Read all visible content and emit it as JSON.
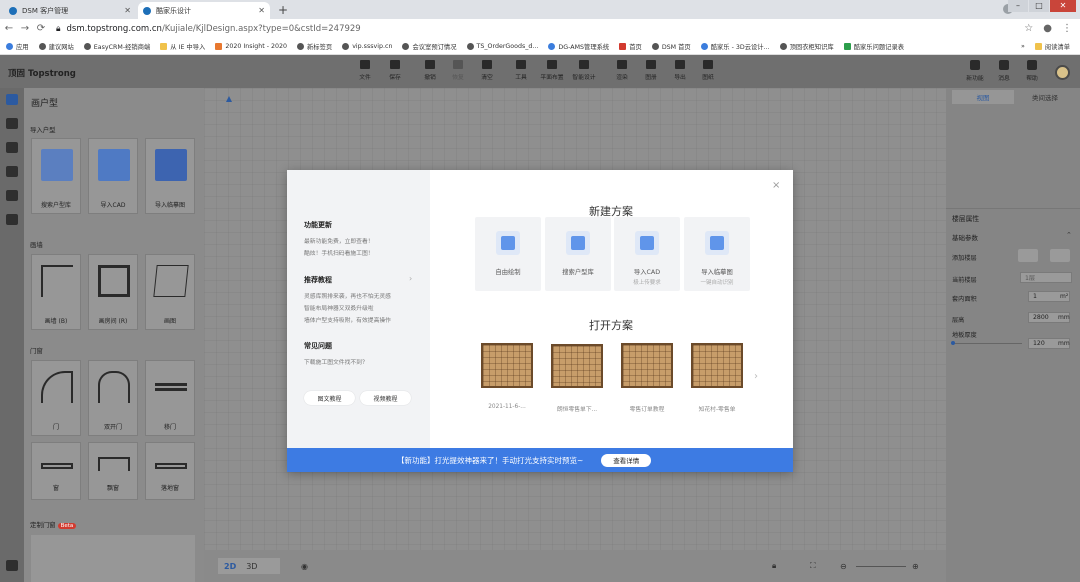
{
  "browser": {
    "tabs": [
      {
        "label": "DSM 客户管理"
      },
      {
        "label": "酷家乐设计"
      }
    ],
    "url_host": "dsm.topstrong.com.cn",
    "url_path": "/Kujiale/KjlDesign.aspx?type=0&cstId=247929",
    "bookmarks": [
      {
        "label": "应用",
        "icon": "apps-icon"
      },
      {
        "label": "建议网站",
        "icon": "globe-icon"
      },
      {
        "label": "EasyCRM-经销商端",
        "icon": "globe-icon"
      },
      {
        "label": "从 IE 中导入",
        "icon": "folder-icon"
      },
      {
        "label": "2020 Insight - 2020",
        "icon": "insight-icon"
      },
      {
        "label": "新标签页",
        "icon": "globe-icon"
      },
      {
        "label": "vip.sssvip.cn",
        "icon": "globe-icon"
      },
      {
        "label": "会议室预订情况",
        "icon": "globe-icon"
      },
      {
        "label": "TS_OrderGoods_d...",
        "icon": "globe-icon"
      },
      {
        "label": "DG-AMS管理系统",
        "icon": "doc-icon"
      },
      {
        "label": "首页",
        "icon": "home-icon"
      },
      {
        "label": "DSM 首页",
        "icon": "globe-icon"
      },
      {
        "label": "酷家乐 - 3D云设计...",
        "icon": "globe-icon"
      },
      {
        "label": "顶固衣柜知识库",
        "icon": "globe-icon"
      },
      {
        "label": "酷家乐问题记录表",
        "icon": "sheet-icon"
      }
    ],
    "bookmark_more": "»",
    "reading_list": "阅读清单"
  },
  "app": {
    "logo": "顶固 Topstrong",
    "toolbar": [
      {
        "label": "文件",
        "icon": "file-icon"
      },
      {
        "label": "保存",
        "icon": "save-icon"
      },
      {
        "label": "撤销",
        "icon": "undo-icon"
      },
      {
        "label": "恢复",
        "icon": "redo-icon"
      },
      {
        "label": "清空",
        "icon": "clear-icon"
      },
      {
        "label": "工具",
        "icon": "tools-icon"
      },
      {
        "label": "平面布置",
        "icon": "layout-icon"
      },
      {
        "label": "智能设计",
        "icon": "smart-icon"
      },
      {
        "label": "渲染",
        "icon": "camera-icon"
      },
      {
        "label": "图册",
        "icon": "album-icon"
      },
      {
        "label": "导出",
        "icon": "export-icon"
      },
      {
        "label": "图纸",
        "icon": "drawing-icon"
      }
    ],
    "right_tools": [
      {
        "label": "新功能",
        "icon": "new-feature-icon"
      },
      {
        "label": "消息",
        "icon": "bell-icon"
      },
      {
        "label": "帮助",
        "icon": "help-icon"
      }
    ],
    "library": {
      "title": "画户型",
      "section_import": "导入户型",
      "import_items": [
        "搜索户型库",
        "导入CAD",
        "导入临摹图"
      ],
      "section_wall": "画墙",
      "wall_items": [
        "画墙 (B)",
        "画房间 (R)",
        "画图"
      ],
      "section_door": "门窗",
      "door_items": [
        "门",
        "双开门",
        "移门",
        "窗",
        "飘窗",
        "落地窗"
      ],
      "section_custom": "定制门窗",
      "custom_badge": "Beta"
    },
    "view": {
      "mode_2d": "2D",
      "mode_3d": "3D"
    },
    "right_panel": {
      "tabs": [
        "视图",
        "类间选择"
      ],
      "section_title": "楼层属性",
      "sub_title": "基础参数",
      "rows": [
        {
          "label": "添加楼层"
        },
        {
          "label": "当前楼层",
          "value": "1层"
        },
        {
          "label": "套内面积",
          "value": "1",
          "unit": "m²"
        },
        {
          "label": "层高",
          "value": "2800",
          "unit": "mm"
        },
        {
          "label": "地板厚度",
          "value": "120",
          "unit": "mm"
        }
      ]
    }
  },
  "modal": {
    "close": "×",
    "left": {
      "feature_title": "功能更新",
      "feature_lines": [
        "最新功能免费，立即查看！",
        "酷炫！手机扫码看施工图！"
      ],
      "tutorial_title": "推荐教程",
      "tutorial_lines": [
        "灵感库照排来袭，再也不怕无灵感",
        "智能布局神器又双叒升级啦",
        "墙体户型支持吸附，有效提高操作"
      ],
      "faq_title": "常见问题",
      "faq_lines": [
        "下载施工图文件找不到？"
      ],
      "btn_text_tutorial": "图文教程",
      "btn_video_tutorial": "视频教程"
    },
    "new_title": "新建方案",
    "options": [
      {
        "label": "自由绘制",
        "sub": ""
      },
      {
        "label": "搜索户型库",
        "sub": ""
      },
      {
        "label": "导入CAD",
        "sub": "极上传要求"
      },
      {
        "label": "导入临摹图",
        "sub": "一键自动识别"
      }
    ],
    "open_title": "打开方案",
    "recent": [
      {
        "label": "2021-11-6-..."
      },
      {
        "label": "朗恒零售单下..."
      },
      {
        "label": "零售订单教程"
      },
      {
        "label": "知花村-零售单"
      }
    ],
    "next_arrow": "›",
    "banner": {
      "text": "【新功能】打光提效神器来了！手动打光支持实时预览~",
      "button": "查看详情"
    }
  }
}
